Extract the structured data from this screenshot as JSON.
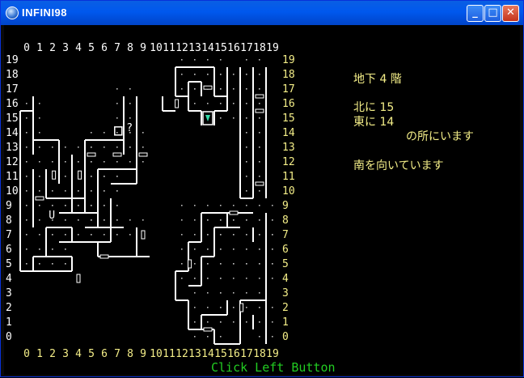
{
  "window": {
    "title": "INFINI98",
    "buttons": {
      "minimize": "_",
      "maximize": "□",
      "close": "✕"
    }
  },
  "axis": {
    "columns": [
      "0",
      "1",
      "2",
      "3",
      "4",
      "5",
      "6",
      "7",
      "8",
      "9",
      "10",
      "11",
      "12",
      "13",
      "14",
      "15",
      "16",
      "17",
      "18",
      "19"
    ],
    "rows": [
      "19",
      "18",
      "17",
      "16",
      "15",
      "14",
      "13",
      "12",
      "11",
      "10",
      "9",
      "8",
      "7",
      "6",
      "5",
      "4",
      "3",
      "2",
      "1",
      "0"
    ]
  },
  "info": {
    "floor": "地下 4 階",
    "north": "北に 15",
    "east": "東に 14",
    "location": "の所にいます",
    "facing": "南を向いています"
  },
  "map_marks": {
    "unknown": "?",
    "up": "U"
  },
  "status": "Click Left Button",
  "colors": {
    "map": "#ffffff",
    "axis": "#ffffff",
    "axis_right": "#f4ee88",
    "info": "#f4ee88",
    "status": "#22cc22",
    "player": "#33ddaa"
  }
}
